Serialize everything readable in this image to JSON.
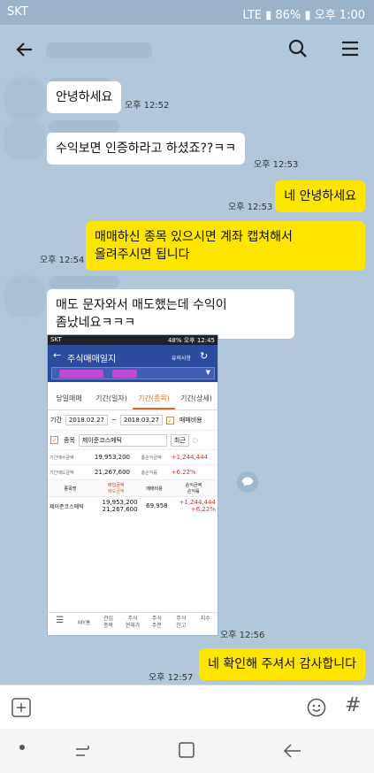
{
  "status_bar": {
    "carrier": "SKT",
    "battery": "86%",
    "ampm": "오후",
    "time": "1:00",
    "network": "LTE"
  },
  "messages": [
    {
      "type": "in",
      "text": "안녕하세요",
      "time": "오후 12:52"
    },
    {
      "type": "in",
      "text": "수익보면 인증하라고 하셨죠??ㅋㅋ",
      "time": "오후 12:53"
    },
    {
      "type": "out",
      "text": "네 안녕하세요",
      "time": "오후 12:53"
    },
    {
      "type": "out",
      "text": "매매하신 종목 있으시면 계좌 캡쳐해서\n올려주시면 됩니다",
      "time": "오후 12:54"
    },
    {
      "type": "in",
      "text": "매도 문자와서 매도했는데 수익이\n좀났네요ㅋㅋㅋ",
      "time": ""
    },
    {
      "type": "in-image",
      "time": "오후 12:56"
    },
    {
      "type": "out",
      "text": "네 확인해 주셔서 감사합니다",
      "time": "오후 12:57"
    }
  ],
  "shared_image": {
    "status_left": "SKT",
    "status_right": "48% 오후 12:45",
    "title": "주식매매일지",
    "notice": "유의사항",
    "tabs": [
      "당일매매",
      "기간(일자)",
      "기간(종목)",
      "기간(상세)"
    ],
    "period_label": "기간",
    "date_from": "2018.02.27",
    "date_to": "2018.03.27",
    "fee_label": "매매비용",
    "stock_check_label": "종목",
    "stock_name": "제이준코스메틱",
    "recent_btn": "최근",
    "summary": [
      {
        "k1": "기간매수금액",
        "v1": "19,953,200",
        "k2": "총손익금액",
        "v2": "+1,244,444"
      },
      {
        "k1": "기간매도금액",
        "v1": "21,267,600",
        "k2": "총손익률",
        "v2": "+6.22%"
      }
    ],
    "table_header": {
      "col1": "종목명",
      "col2a": "매입금액",
      "col2b": "매도금액",
      "col3": "매매비용",
      "col4a": "손익금액",
      "col4b": "손익률"
    },
    "table_row": {
      "name": "제이준코스메틱",
      "buy": "19,953,200",
      "sell": "21,267,600",
      "fee": "69,958",
      "pnl": "+1,244,444",
      "rate": "+6.22%"
    },
    "bottom_nav": [
      "MY홈",
      "관심\n종목",
      "주식\n현재가",
      "주식\n주문",
      "주식\n잔고",
      "지수"
    ]
  },
  "colors": {
    "chat_bg": "#b2c7da",
    "my_bubble": "#fee500",
    "other_bubble": "#ffffff"
  }
}
